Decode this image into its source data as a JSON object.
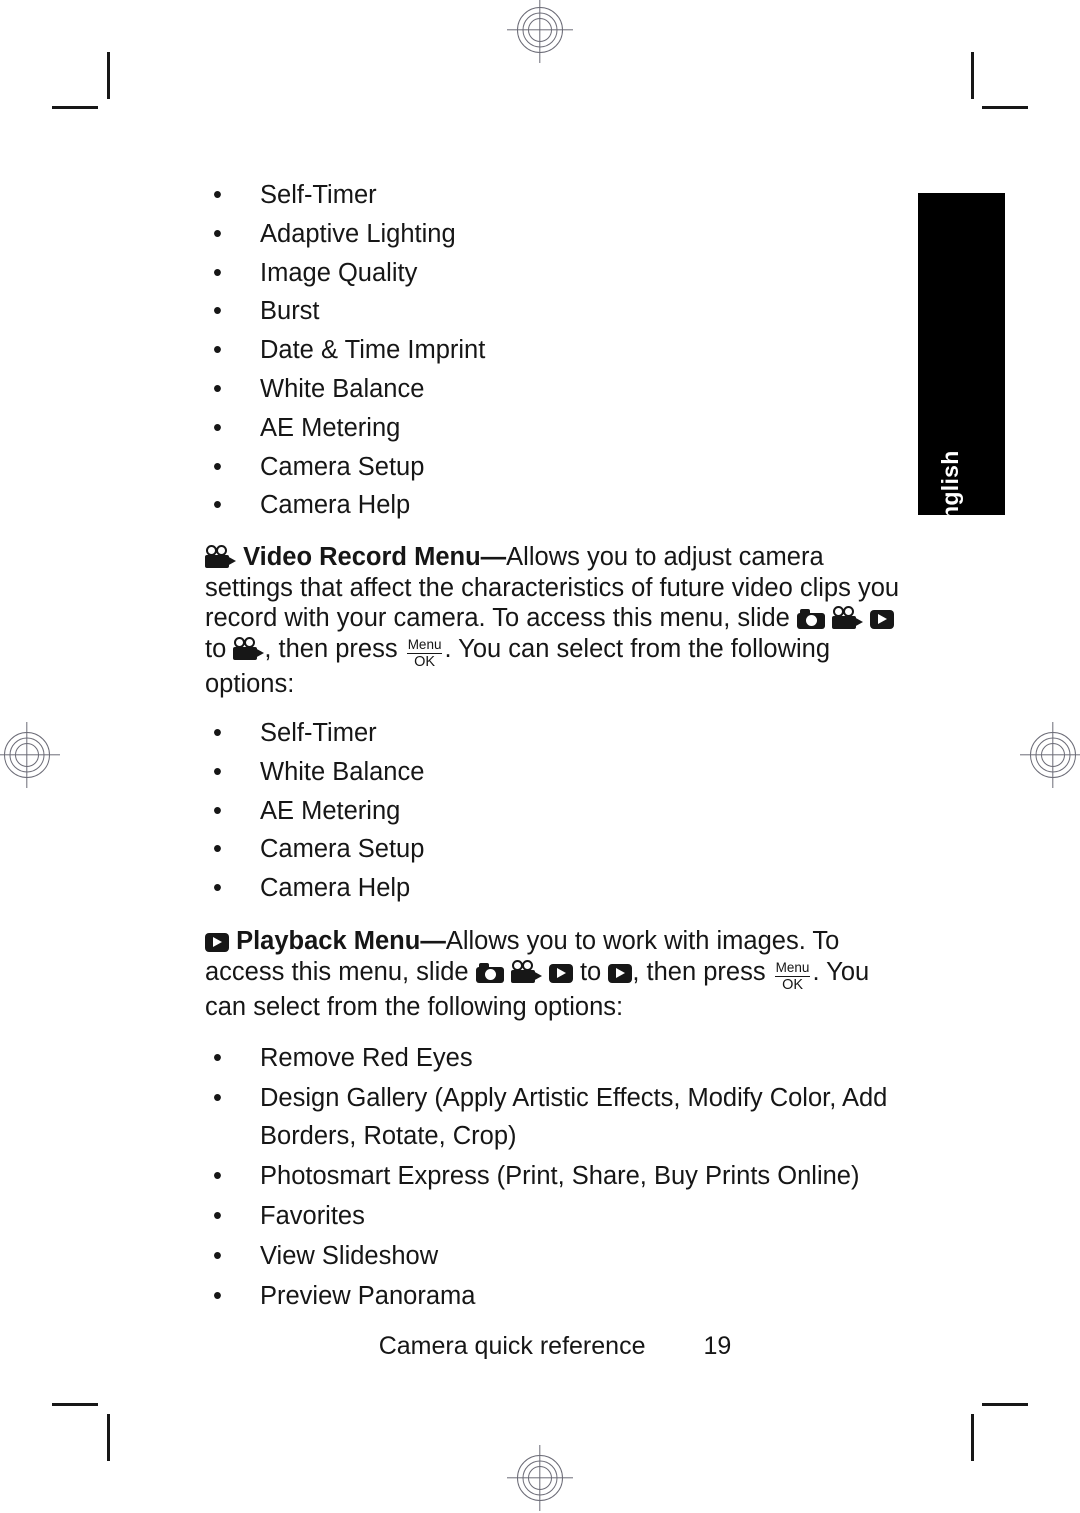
{
  "page": {
    "language_tab": "English",
    "footer_title": "Camera quick reference",
    "footer_page_number": "19",
    "text_color": "#161616",
    "tab_background": "#000000",
    "tab_text_color": "#ffffff",
    "mark_color": "#6b6b76"
  },
  "bullet_glyph": "•",
  "capture_menu_options": [
    "Self-Timer",
    "Adaptive Lighting",
    "Image Quality",
    "Burst",
    "Date & Time Imprint",
    "White Balance",
    "AE Metering",
    "Camera Setup",
    "Camera Help"
  ],
  "video_record_menu": {
    "heading": "Video Record Menu",
    "dash": "—",
    "text_1": "Allows you to adjust camera settings that affect the characteristics of future video clips you record with your camera. To access this menu, slide ",
    "text_2": " to ",
    "text_3": ", then press ",
    "text_4": ". You can select from the following options:",
    "menu_button_top": "Menu",
    "menu_button_bottom": "OK",
    "options": [
      "Self-Timer",
      "White Balance",
      "AE Metering",
      "Camera Setup",
      "Camera Help"
    ]
  },
  "playback_menu": {
    "heading": "Playback Menu",
    "dash": "—",
    "text_1": "Allows you to work with images. To access this menu, slide ",
    "text_2": " to ",
    "text_3": ", then press ",
    "text_4": ". You can select from the following options:",
    "menu_button_top": "Menu",
    "menu_button_bottom": "OK",
    "options": [
      "Remove Red Eyes",
      "Design Gallery (Apply Artistic Effects, Modify Color, Add Borders, Rotate, Crop)",
      "Photosmart Express (Print, Share, Buy Prints Online)",
      "Favorites",
      "View Slideshow",
      "Preview Panorama"
    ]
  }
}
